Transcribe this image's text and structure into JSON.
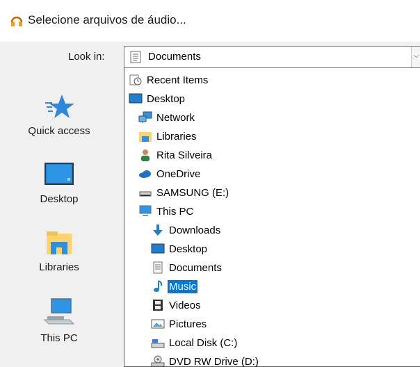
{
  "window": {
    "title": "Selecione arquivos de áudio...",
    "title_icon": "headphones-icon"
  },
  "look_in": {
    "label": "Look in:",
    "value": "Documents",
    "icon": "documents-icon"
  },
  "places": [
    {
      "label": "Quick access",
      "icon": "star-icon"
    },
    {
      "label": "Desktop",
      "icon": "desktop-icon"
    },
    {
      "label": "Libraries",
      "icon": "libraries-icon"
    },
    {
      "label": "This PC",
      "icon": "computer-icon"
    }
  ],
  "dropdown": {
    "items": [
      {
        "label": "Recent Items",
        "icon": "recent-items-icon",
        "level": 0
      },
      {
        "label": "Desktop",
        "icon": "desktop-icon",
        "level": 0
      },
      {
        "label": "Network",
        "icon": "network-icon",
        "level": 1
      },
      {
        "label": "Libraries",
        "icon": "libraries-icon",
        "level": 1
      },
      {
        "label": "Rita Silveira",
        "icon": "user-icon",
        "level": 1
      },
      {
        "label": "OneDrive",
        "icon": "onedrive-icon",
        "level": 1
      },
      {
        "label": "SAMSUNG (E:)",
        "icon": "drive-icon",
        "level": 1
      },
      {
        "label": "This PC",
        "icon": "computer-icon",
        "level": 1
      },
      {
        "label": "Downloads",
        "icon": "downloads-icon",
        "level": 2
      },
      {
        "label": "Desktop",
        "icon": "desktop-icon",
        "level": 2
      },
      {
        "label": "Documents",
        "icon": "documents-icon",
        "level": 2
      },
      {
        "label": "Music",
        "icon": "music-icon",
        "level": 2,
        "selected": true
      },
      {
        "label": "Videos",
        "icon": "videos-icon",
        "level": 2
      },
      {
        "label": "Pictures",
        "icon": "pictures-icon",
        "level": 2
      },
      {
        "label": "Local Disk (C:)",
        "icon": "local-disk-icon",
        "level": 2
      },
      {
        "label": "DVD RW Drive (D:)",
        "icon": "dvd-drive-icon",
        "level": 2
      }
    ]
  },
  "colors": {
    "selection": "#0078d7",
    "panel_background": "#f0f0f0"
  }
}
